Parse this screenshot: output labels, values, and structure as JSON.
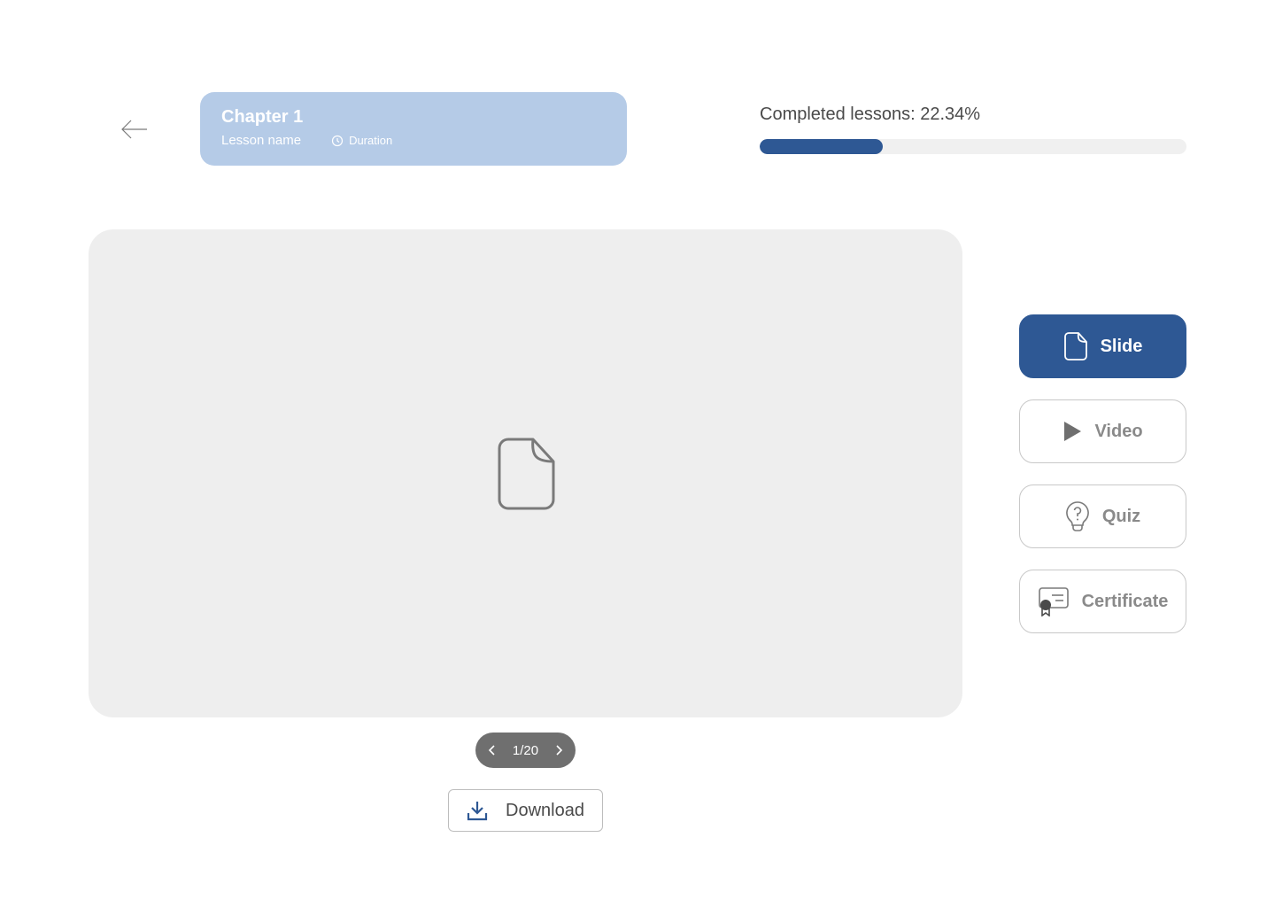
{
  "lesson": {
    "chapter": "Chapter 1",
    "name": "Lesson name",
    "duration": "Duration"
  },
  "progress": {
    "label": "Completed lessons: 22.34%",
    "percent": 22.34
  },
  "pager": {
    "text": "1/20"
  },
  "download": {
    "label": "Download"
  },
  "modes": {
    "slide": "Slide",
    "video": "Video",
    "quiz": "Quiz",
    "certificate": "Certificate"
  },
  "colors": {
    "accent": "#2e5894",
    "card": "#b5cbe7",
    "viewer": "#eeeeee"
  },
  "icons": {
    "back": "arrow-left-icon",
    "duration": "clock-icon",
    "viewer": "document-icon",
    "download": "download-icon",
    "slide": "document-icon",
    "video": "play-icon",
    "quiz": "lightbulb-question-icon",
    "certificate": "certificate-icon"
  }
}
